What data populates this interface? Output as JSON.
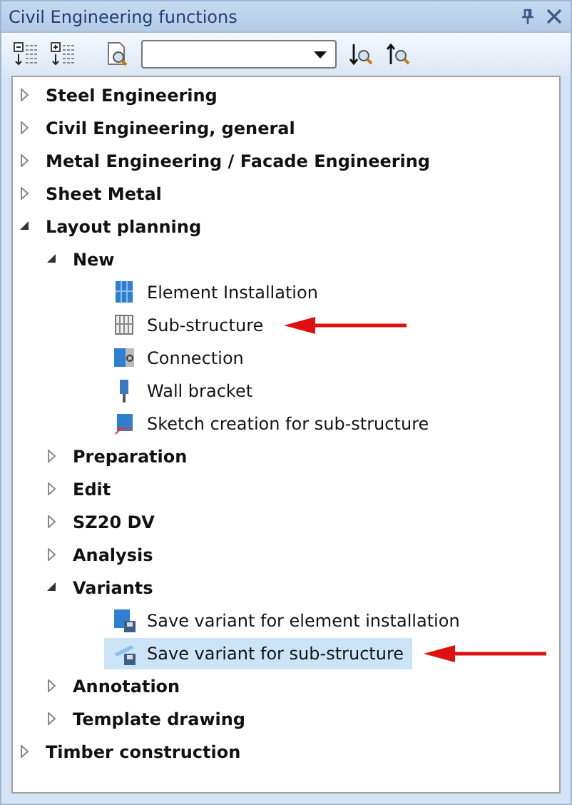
{
  "window": {
    "title": "Civil Engineering functions"
  },
  "tree": [
    {
      "label": "Steel Engineering",
      "expanded": false
    },
    {
      "label": "Civil Engineering, general",
      "expanded": false
    },
    {
      "label": "Metal Engineering / Facade Engineering",
      "expanded": false
    },
    {
      "label": "Sheet Metal",
      "expanded": false
    },
    {
      "label": "Layout planning",
      "expanded": true,
      "children": [
        {
          "label": "New",
          "expanded": true,
          "children": [
            {
              "label": "Element Installation",
              "kind": "panel",
              "selected": false,
              "marked": false
            },
            {
              "label": "Sub-structure",
              "kind": "grid",
              "selected": false,
              "marked": true
            },
            {
              "label": "Connection",
              "kind": "connection",
              "selected": false,
              "marked": false
            },
            {
              "label": "Wall bracket",
              "kind": "bracket",
              "selected": false,
              "marked": false
            },
            {
              "label": "Sketch creation for sub-structure",
              "kind": "sketch",
              "selected": false,
              "marked": false
            }
          ]
        },
        {
          "label": "Preparation",
          "expanded": false
        },
        {
          "label": "Edit",
          "expanded": false
        },
        {
          "label": "SZ20 DV",
          "expanded": false
        },
        {
          "label": "Analysis",
          "expanded": false
        },
        {
          "label": "Variants",
          "expanded": true,
          "children": [
            {
              "label": "Save variant for element installation",
              "kind": "save-panel",
              "selected": false,
              "marked": false
            },
            {
              "label": "Save variant for sub-structure",
              "kind": "save-profile",
              "selected": true,
              "marked": true
            }
          ]
        },
        {
          "label": "Annotation",
          "expanded": false
        },
        {
          "label": "Template drawing",
          "expanded": false
        }
      ]
    },
    {
      "label": "Timber construction",
      "expanded": false
    }
  ]
}
